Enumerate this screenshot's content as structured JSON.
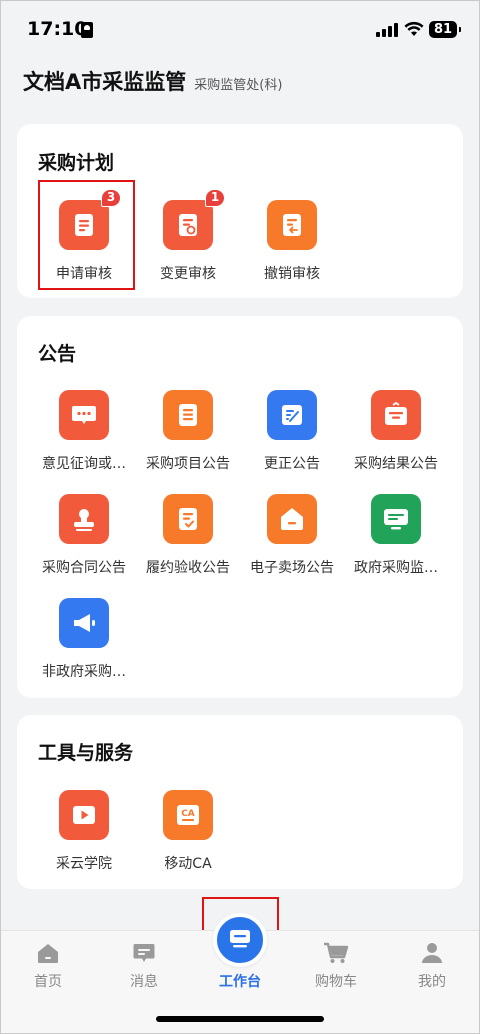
{
  "status_bar": {
    "time": "17:10",
    "battery": "81"
  },
  "header": {
    "title": "文档A市采监监管",
    "subtitle": "采购监管处(科)"
  },
  "sections": {
    "plan": {
      "title": "采购计划",
      "items": [
        {
          "label": "申请审核",
          "badge": "3",
          "icon": "document-list-icon",
          "color": "#f25a3c"
        },
        {
          "label": "变更审核",
          "badge": "1",
          "icon": "document-refresh-icon",
          "color": "#f25a3c"
        },
        {
          "label": "撤销审核",
          "badge": "",
          "icon": "document-undo-icon",
          "color": "#f7792a"
        }
      ]
    },
    "notice": {
      "title": "公告",
      "items": [
        {
          "label": "意见征询或…",
          "icon": "chat-bubble-icon",
          "color": "#f25a3c"
        },
        {
          "label": "采购项目公告",
          "icon": "document-lines-icon",
          "color": "#f7792a"
        },
        {
          "label": "更正公告",
          "icon": "edit-document-icon",
          "color": "#3479f0"
        },
        {
          "label": "采购结果公告",
          "icon": "briefcase-icon",
          "color": "#f25a3c"
        },
        {
          "label": "采购合同公告",
          "icon": "stamp-icon",
          "color": "#f25a3c"
        },
        {
          "label": "履约验收公告",
          "icon": "check-document-icon",
          "color": "#f7792a"
        },
        {
          "label": "电子卖场公告",
          "icon": "home-icon",
          "color": "#f7792a"
        },
        {
          "label": "政府采购监…",
          "icon": "monitor-icon",
          "color": "#22a35a"
        },
        {
          "label": "非政府采购…",
          "icon": "megaphone-icon",
          "color": "#3479f0"
        }
      ]
    },
    "tools": {
      "title": "工具与服务",
      "items": [
        {
          "label": "采云学院",
          "icon": "video-camera-icon",
          "color": "#f25a3c"
        },
        {
          "label": "移动CA",
          "icon": "ca-certificate-icon",
          "color": "#f7792a",
          "icon_text": "CA"
        }
      ]
    }
  },
  "tab_bar": {
    "items": [
      {
        "label": "首页",
        "icon": "home-tab-icon",
        "active": false
      },
      {
        "label": "消息",
        "icon": "message-tab-icon",
        "active": false
      },
      {
        "label": "工作台",
        "icon": "workbench-tab-icon",
        "active": true
      },
      {
        "label": "购物车",
        "icon": "cart-tab-icon",
        "active": false
      },
      {
        "label": "我的",
        "icon": "profile-tab-icon",
        "active": false
      }
    ]
  },
  "colors": {
    "accent": "#2a74ea",
    "highlight": "#e01414",
    "badge": "#e8413b"
  }
}
